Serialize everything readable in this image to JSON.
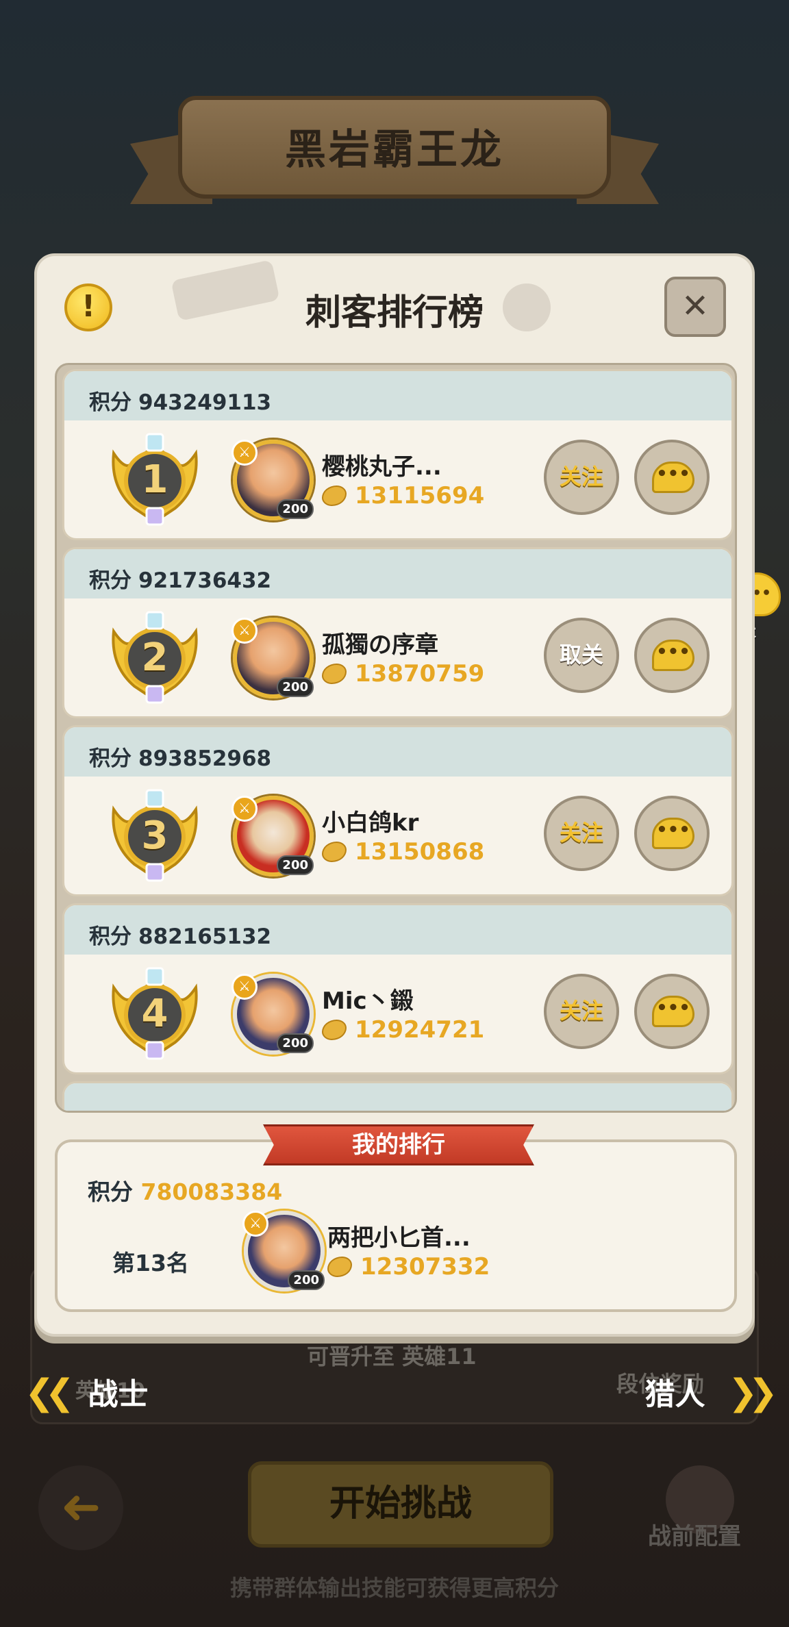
{
  "banner": {
    "title": "黑岩霸王龙"
  },
  "panel": {
    "title": "刺客排行榜",
    "info_icon": "!",
    "close_icon": "✕"
  },
  "score_label": "积分",
  "entries": [
    {
      "rank": "1",
      "score": "943249113",
      "name": "樱桃丸子...",
      "level": "200",
      "power": "13115694",
      "action": "关注",
      "action_state": "follow"
    },
    {
      "rank": "2",
      "score": "921736432",
      "name": "孤獨の序章",
      "level": "200",
      "power": "13870759",
      "action": "取关",
      "action_state": "unfollow"
    },
    {
      "rank": "3",
      "score": "893852968",
      "name": "小白鸽kr",
      "level": "200",
      "power": "13150868",
      "action": "关注",
      "action_state": "follow"
    },
    {
      "rank": "4",
      "score": "882165132",
      "name": "Mic丶鎩",
      "level": "200",
      "power": "12924721",
      "action": "关注",
      "action_state": "follow"
    }
  ],
  "my_rank": {
    "ribbon": "我的排行",
    "score_label": "积分",
    "score": "780083384",
    "rank_text": "第13名",
    "name": "两把小匕首...",
    "level": "200",
    "power": "12307332"
  },
  "float_chat": {
    "label": "聊天",
    "icon": "•••"
  },
  "background": {
    "promote_text": "可晋升至 英雄11",
    "left_hero_text": "英雄10",
    "reward_text": "段位奖励"
  },
  "nav": {
    "prev": "战士",
    "next": "猎人"
  },
  "start_button": "开始挑战",
  "prep_button": "战前配置",
  "hint": "携带群体输出技能可获得更高积分",
  "colors": {
    "accent": "#e7a723",
    "ribbon": "#c23a26",
    "panel": "#f1ece0"
  }
}
